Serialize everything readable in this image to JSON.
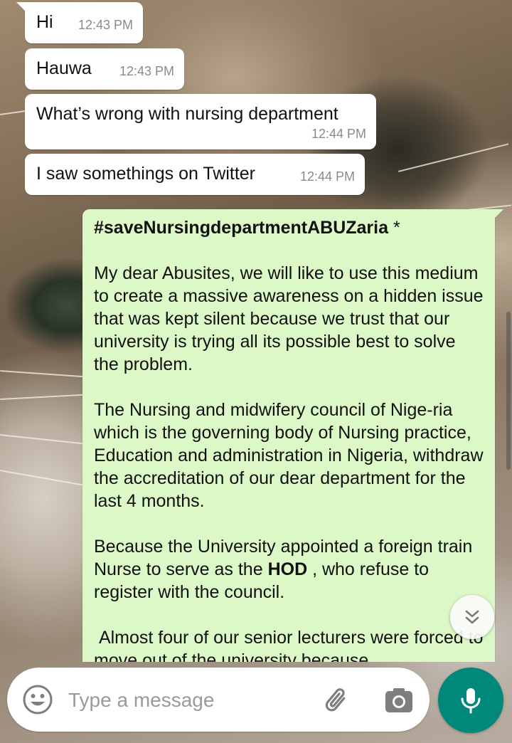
{
  "messages": [
    {
      "text": "Hi",
      "time": "12:43 PM"
    },
    {
      "text": "Hauwa",
      "time": "12:43 PM"
    },
    {
      "text": "What’s wrong with nursing department",
      "time": "12:44 PM"
    },
    {
      "text": "I saw somethings on Twitter",
      "time": "12:44 PM"
    }
  ],
  "outgoing": {
    "hashtag": "#saveNursingdepartmentABUZaria",
    "hashtag_suffix": " *",
    "para1": "My dear Abusites, we will like to use this medium to create a massive awareness on a hidden issue that was kept silent because we trust that our university is trying all its possible best to solve the problem.",
    "para2": "The Nursing and midwifery council of Nige-ria which is the governing body of Nursing practice, Education and administration in Nigeria, withdraw the accreditation of our dear department for the last 4 months.",
    "para3_before": "Because the University appointed a foreign train Nurse to serve as the ",
    "para3_bold": "HOD",
    "para3_after": " , who refuse to register with the council.",
    "para4": " Almost four of our senior lecturers were forced to move out of the university because"
  },
  "input": {
    "placeholder": "Type a message",
    "value": ""
  },
  "icons": {
    "emoji": "emoji-icon",
    "attach": "paperclip-icon",
    "camera": "camera-icon",
    "mic": "microphone-icon",
    "scroll": "chevron-double-down-icon"
  },
  "colors": {
    "outgoing_bubble": "#dcf8c6",
    "incoming_bubble": "#ffffff",
    "mic_button": "#00897b",
    "timestamp": "#8a8a8a"
  }
}
